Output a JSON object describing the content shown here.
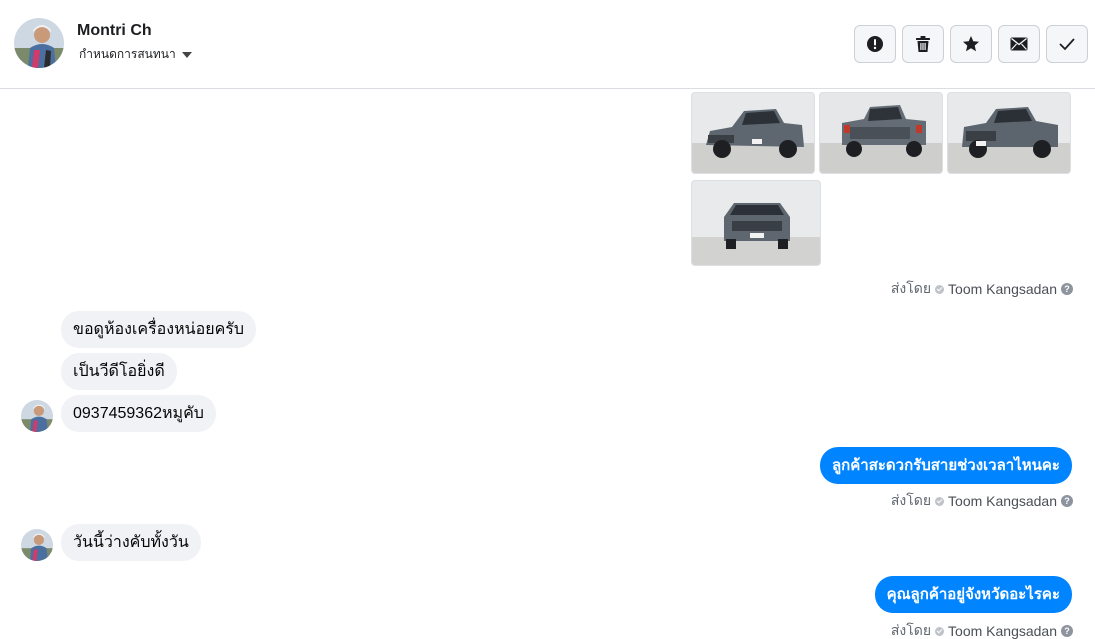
{
  "header": {
    "contact_name": "Montri Ch",
    "subtitle": "กำหนดการสนทนา",
    "tools": [
      {
        "name": "report-button",
        "icon": "exclamation-icon"
      },
      {
        "name": "delete-button",
        "icon": "trash-icon"
      },
      {
        "name": "star-button",
        "icon": "star-icon"
      },
      {
        "name": "mark-unread-button",
        "icon": "envelope-icon"
      },
      {
        "name": "mark-done-button",
        "icon": "checkmark-icon"
      }
    ]
  },
  "colors": {
    "accent": "#0084ff",
    "incoming_bubble": "#f0f2f5",
    "divider": "#dadde1",
    "meta_text": "#606770"
  },
  "sent_prefix": "ส่งโดย",
  "page_author": "Toom Kangsadan",
  "images": [
    {
      "icon": "pickup-truck-front-three-quarter-photo"
    },
    {
      "icon": "pickup-truck-rear-photo"
    },
    {
      "icon": "pickup-truck-front-three-quarter-photo"
    },
    {
      "icon": "pickup-truck-front-photo"
    }
  ],
  "messages": {
    "in_1": "ขอดูห้องเครื่องหน่อยครับ",
    "in_2": "เป็นวีดีโอยิ่งดี",
    "in_3": "0937459362หมูคับ",
    "out_1": "ลูกค้าสะดวกรับสายช่วงเวลาไหนคะ",
    "in_4": "วันนี้ว่างคับทั้งวัน",
    "out_2": "คุณลูกค้าอยู่จังหวัดอะไรคะ"
  }
}
